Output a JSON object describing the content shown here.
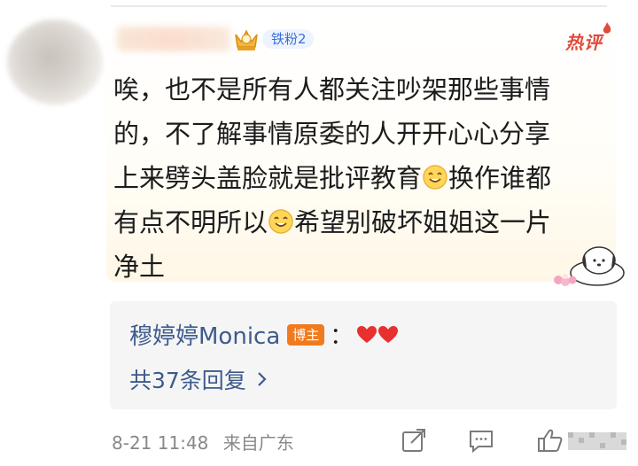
{
  "comment": {
    "fan_badge": "铁粉2",
    "hot_label": "热评",
    "text_lines": [
      "唉，也不是所有人都关注吵架那些事情",
      "的，不了解事情原委的人开开心心分享",
      "上来劈头盖脸就是批评教育",
      "换作谁都",
      "有点不明所以",
      "希望别破坏姐姐这一片",
      "净土"
    ],
    "emoji_name": "smile-face-emoji"
  },
  "reply": {
    "author": "穆婷婷Monica",
    "host_tag": "博主",
    "colon": "：",
    "hearts": "❤❤",
    "more_replies": "共37条回复"
  },
  "meta": {
    "date": "8-21 11:48",
    "source": "来自广东"
  },
  "colors": {
    "link_blue": "#3d5b8c",
    "hot_red": "#e24a3a",
    "host_orange": "#f07b1f"
  }
}
